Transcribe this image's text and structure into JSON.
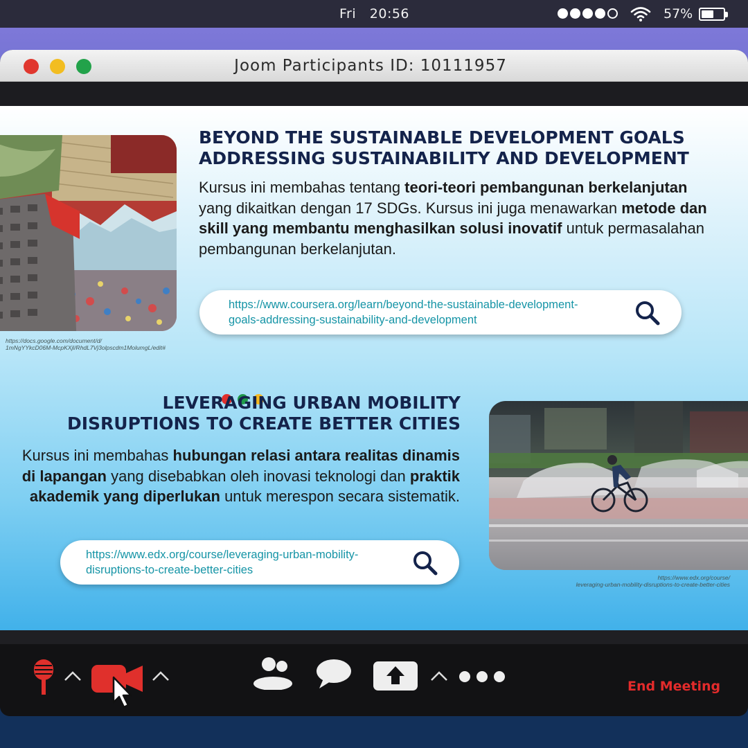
{
  "status_bar": {
    "day": "Fri",
    "time": "20:56",
    "battery_percent": "57%",
    "battery_level": 0.57,
    "signal_bars": 4,
    "signal_total": 5
  },
  "window": {
    "title": "Joom Participants ID: 10111957"
  },
  "course1": {
    "title_line1": "BEYOND THE SUSTAINABLE DEVELOPMENT GOALS",
    "title_line2": "ADDRESSING SUSTAINABILITY AND DEVELOPMENT",
    "desc": [
      {
        "text": "Kursus ini membahas tentang ",
        "bold": false
      },
      {
        "text": "teori-teori pembangunan berkelanjutan",
        "bold": true
      },
      {
        "text": " yang dikaitkan dengan 17 SDGs. Kursus ini juga menawarkan ",
        "bold": false
      },
      {
        "text": "metode dan skill yang membantu menghasilkan solusi inovatif",
        "bold": true
      },
      {
        "text": " untuk permasalahan pembangunan berkelanjutan.",
        "bold": false
      }
    ],
    "url_line1": "https://www.coursera.org/learn/beyond-the-sustainable-development-",
    "url_line2": "goals-addressing-sustainability-and-development",
    "image_credit_line1": "https://docs.google.com/document/d/",
    "image_credit_line2": "1mNgYYkcD06M-McpKXjl/RhdL7Vj3olpscdm1MolumgL/edit#"
  },
  "course2": {
    "title_line1": "LEVERAGING URBAN MOBILITY",
    "title_line2": "DISRUPTIONS TO CREATE BETTER CITIES",
    "desc": [
      {
        "text": "Kursus ini membahas ",
        "bold": false
      },
      {
        "text": "hubungan relasi antara realitas dinamis di lapangan",
        "bold": true
      },
      {
        "text": " yang disebabkan oleh inovasi teknologi dan ",
        "bold": false
      },
      {
        "text": "praktik akademik yang diperlukan",
        "bold": true
      },
      {
        "text": " untuk merespon secara sistematik.",
        "bold": false
      }
    ],
    "url_line1": "https://www.edx.org/course/leveraging-urban-mobility-",
    "url_line2": "disruptions-to-create-better-cities",
    "image_credit_line1": "https://www.edx.org/course/",
    "image_credit_line2": "leveraging-urban-mobility-disruptions-to-create-better-cities"
  },
  "controls": {
    "end_meeting_label": "End Meeting",
    "icons": [
      "microphone-icon",
      "chevron-up-icon",
      "video-camera-icon",
      "chevron-up-icon",
      "participants-icon",
      "chat-icon",
      "share-screen-icon",
      "chevron-up-icon",
      "more-icon"
    ]
  },
  "colors": {
    "heading": "#14234b",
    "link": "#1594a6",
    "end_meeting": "#e32b2b",
    "dot_red": "#e0302c",
    "dot_green": "#1f9a4a",
    "dot_yellow": "#f5b921"
  }
}
